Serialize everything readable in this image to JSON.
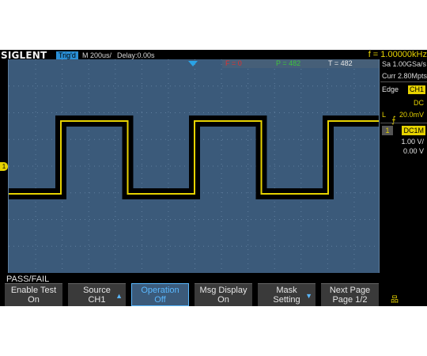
{
  "top_bar": {
    "logo": "SIGLENT",
    "trigger_status": "Trig'd",
    "timebase": "M 200us/",
    "delay": "Delay:0.00s",
    "frequency": "f = 1.00000kHz"
  },
  "measurements": {
    "f": "F = 0",
    "p": "P = 482",
    "t": "T = 482"
  },
  "right_panel": {
    "sample_rate": "Sa 1.00GSa/s",
    "memory_depth": "Curr 2.80Mpts",
    "trigger_type": "Edge",
    "trigger_source": "CH1",
    "trigger_coupling": "DC",
    "trigger_level_label": "L",
    "trigger_level": "20.0mV",
    "channel_number": "1",
    "channel_coupling": "DC1M",
    "volts_per_div": "1.00 V/",
    "offset": "0.00 V"
  },
  "markers": {
    "channel": "1"
  },
  "menu": {
    "title": "PASS/FAIL",
    "buttons": [
      {
        "line1": "Enable Test",
        "line2": "On",
        "active": false,
        "arrow": ""
      },
      {
        "line1": "Source",
        "line2": "CH1",
        "active": false,
        "arrow": "up-arrow"
      },
      {
        "line1": "Operation",
        "line2": "Off",
        "active": true,
        "arrow": ""
      },
      {
        "line1": "Msg Display",
        "line2": "On",
        "active": false,
        "arrow": ""
      },
      {
        "line1": "Mask",
        "line2": "Setting",
        "active": false,
        "arrow": "down-arrow"
      },
      {
        "line1": "Next Page",
        "line2": "Page 1/2",
        "active": false,
        "arrow": ""
      }
    ]
  },
  "colors": {
    "ch1": "#e6d200",
    "grid_bg": "#3b5a7a",
    "accent": "#2a8fd6"
  },
  "icons": {
    "net": "network-icon",
    "edge": "rising-edge-icon"
  },
  "waveform": {
    "type": "square",
    "frequency_hz": 1000,
    "duty_cycle": 0.5
  }
}
